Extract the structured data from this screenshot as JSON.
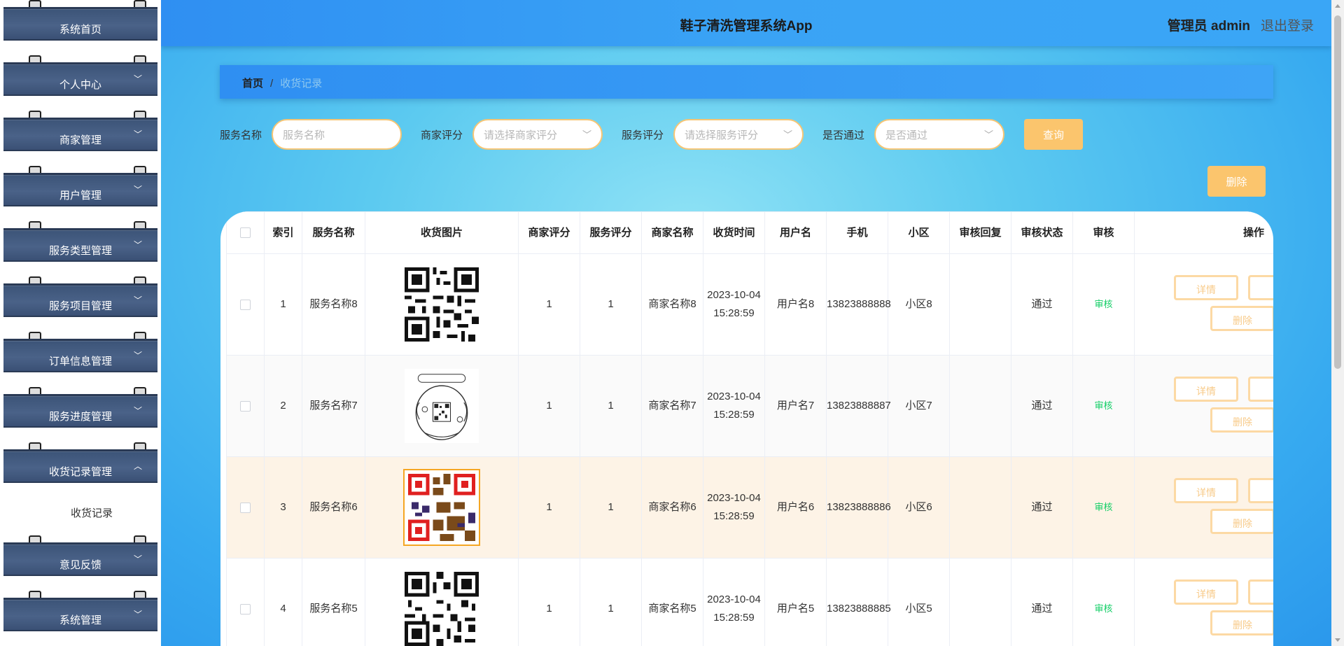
{
  "app": {
    "title": "鞋子清洗管理系统App",
    "user_label": "管理员 admin",
    "logout_label": "退出登录"
  },
  "sidebar": {
    "items": [
      {
        "label": "系统首页",
        "arrow": ""
      },
      {
        "label": "个人中心",
        "arrow": "﹀"
      },
      {
        "label": "商家管理",
        "arrow": "﹀"
      },
      {
        "label": "用户管理",
        "arrow": "﹀"
      },
      {
        "label": "服务类型管理",
        "arrow": "﹀"
      },
      {
        "label": "服务项目管理",
        "arrow": "﹀"
      },
      {
        "label": "订单信息管理",
        "arrow": "﹀"
      },
      {
        "label": "服务进度管理",
        "arrow": "﹀"
      },
      {
        "label": "收货记录管理",
        "arrow": "︿"
      },
      {
        "label": "意见反馈",
        "arrow": "﹀"
      },
      {
        "label": "系统管理",
        "arrow": "﹀"
      }
    ],
    "active_submenu": "收货记录"
  },
  "breadcrumb": {
    "home": "首页",
    "separator": "/",
    "current": "收货记录"
  },
  "filters": {
    "service_name": {
      "label": "服务名称",
      "placeholder": "服务名称"
    },
    "merchant_rating": {
      "label": "商家评分",
      "placeholder": "请选择商家评分"
    },
    "service_rating": {
      "label": "服务评分",
      "placeholder": "请选择服务评分"
    },
    "approved": {
      "label": "是否通过",
      "placeholder": "是否通过"
    },
    "query_label": "查询",
    "delete_label": "删除"
  },
  "table": {
    "headers": [
      "索引",
      "服务名称",
      "收货图片",
      "商家评分",
      "服务评分",
      "商家名称",
      "收货时间",
      "用户名",
      "手机",
      "小区",
      "审核回复",
      "审核状态",
      "审核",
      "操作"
    ],
    "rows": [
      {
        "index": "1",
        "service": "服务名称8",
        "merchant_rating": "1",
        "service_rating": "1",
        "merchant": "商家名称8",
        "time": "2023-10-04 15:28:59",
        "user": "用户名8",
        "phone": "13823888888",
        "community": "小区8",
        "reply": "",
        "status": "通过",
        "audit": "审核",
        "image": "qr-code-icon"
      },
      {
        "index": "2",
        "service": "服务名称7",
        "merchant_rating": "1",
        "service_rating": "1",
        "merchant": "商家名称7",
        "time": "2023-10-04 15:28:59",
        "user": "用户名7",
        "phone": "13823888887",
        "community": "小区7",
        "reply": "",
        "status": "通过",
        "audit": "审核",
        "image": "illustrated-qr-icon"
      },
      {
        "index": "3",
        "service": "服务名称6",
        "merchant_rating": "1",
        "service_rating": "1",
        "merchant": "商家名称6",
        "time": "2023-10-04 15:28:59",
        "user": "用户名6",
        "phone": "13823888886",
        "community": "小区6",
        "reply": "",
        "status": "通过",
        "audit": "审核",
        "image": "colored-qr-icon"
      },
      {
        "index": "4",
        "service": "服务名称5",
        "merchant_rating": "1",
        "service_rating": "1",
        "merchant": "商家名称5",
        "time": "2023-10-04 15:28:59",
        "user": "用户名5",
        "phone": "13823888885",
        "community": "小区5",
        "reply": "",
        "status": "通过",
        "audit": "审核",
        "image": "qr-code-icon"
      }
    ],
    "op_detail": "详情",
    "op_delete": "删除"
  },
  "colors": {
    "accent_orange": "#fbc56d",
    "audit_green": "#13ce66",
    "sidebar_blue": "#4a6288"
  }
}
